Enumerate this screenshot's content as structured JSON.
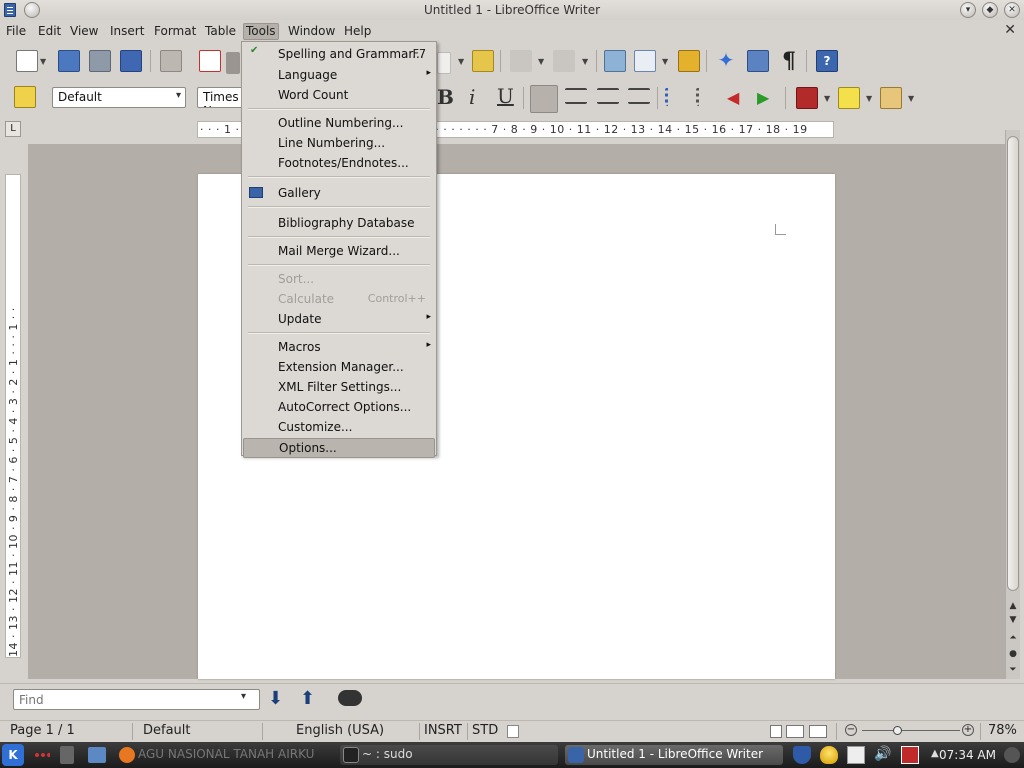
{
  "window": {
    "title": "Untitled 1 - LibreOffice Writer",
    "close_symbol": "✕"
  },
  "menubar": {
    "items": [
      "File",
      "Edit",
      "View",
      "Insert",
      "Format",
      "Table",
      "Tools",
      "Window",
      "Help"
    ],
    "active": "Tools"
  },
  "format_toolbar": {
    "style_value": "Default",
    "font_value": "Times N"
  },
  "ruler": {
    "horizontal": "· · · 1 · · · · · · · · · · · · · · · · · · · · · · · · · · · · · · · · 7 · 8 · 9 · 10 · 11 · 12 · 13 · 14 · 15 · 16 · 17 · 18 · 19",
    "vertical": "14 · 13 · 12 · 11 · 10 · 9 · 8 · 7 · 6 · 5 · 4 · 3 · 2 · 1 · · · 1 · ·"
  },
  "tools_menu": {
    "items": [
      {
        "label": "Spelling and Grammar...",
        "shortcut": "F7",
        "icon": "spellcheck-icon"
      },
      {
        "label": "Language",
        "submenu": true
      },
      {
        "label": "Word Count"
      },
      {
        "label": "Outline Numbering..."
      },
      {
        "label": "Line Numbering..."
      },
      {
        "label": "Footnotes/Endnotes..."
      },
      {
        "label": "Gallery",
        "icon": "gallery-icon"
      },
      {
        "label": "Bibliography Database"
      },
      {
        "label": "Mail Merge Wizard..."
      },
      {
        "label": "Sort...",
        "disabled": true
      },
      {
        "label": "Calculate",
        "shortcut": "Control++",
        "disabled": true
      },
      {
        "label": "Update",
        "submenu": true
      },
      {
        "label": "Macros",
        "submenu": true
      },
      {
        "label": "Extension Manager..."
      },
      {
        "label": "XML Filter Settings..."
      },
      {
        "label": "AutoCorrect Options..."
      },
      {
        "label": "Customize..."
      },
      {
        "label": "Options...",
        "highlighted": true
      }
    ],
    "submenu_arrow": "▸"
  },
  "findbar": {
    "placeholder": "Find"
  },
  "statusbar": {
    "page": "Page 1 / 1",
    "page_style": "Default",
    "language": "English (USA)",
    "insert_mode": "INSRT",
    "selection_mode": "STD",
    "zoom": "78%",
    "zoom_value": 0.78
  },
  "taskbar": {
    "tasks": [
      {
        "label": "AGU NASIONAL TANAH AIRKU"
      },
      {
        "label": "~ : sudo"
      },
      {
        "label": "Untitled 1 - LibreOffice Writer"
      }
    ],
    "clock": "07:34 AM"
  },
  "colors": {
    "menu_bg": "#dcd8d3",
    "highlight": "#b9b4ad",
    "disabled_text": "#a29d97",
    "accent_blue": "#3a64a8"
  }
}
